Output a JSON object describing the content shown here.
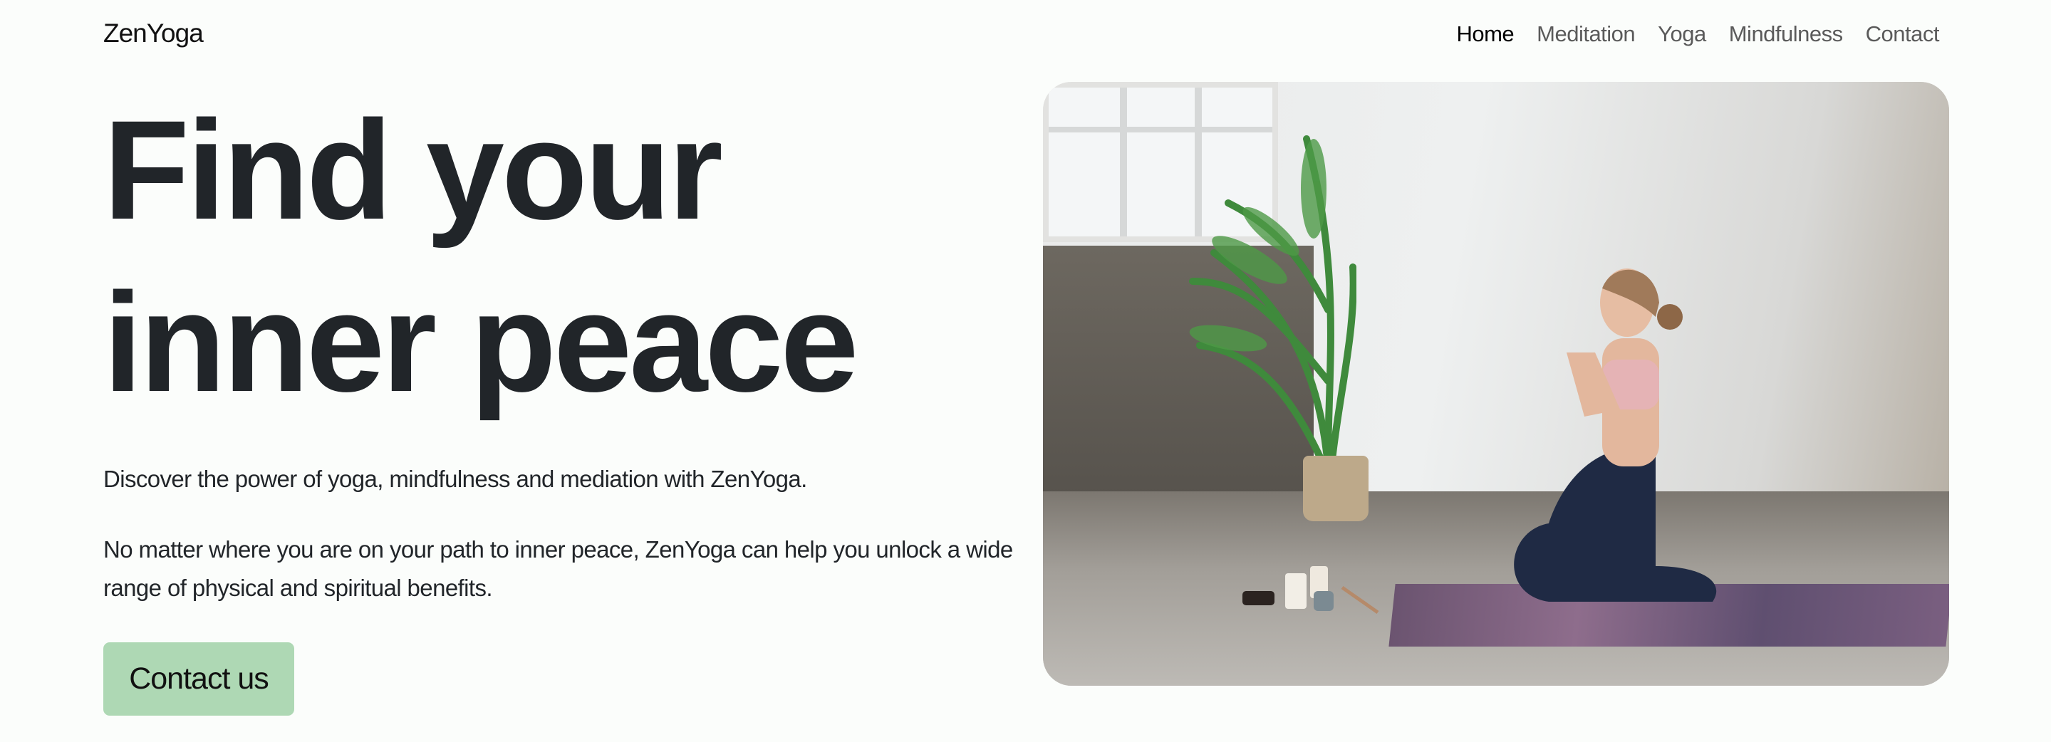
{
  "header": {
    "logo": "ZenYoga",
    "nav": [
      {
        "label": "Home",
        "active": true
      },
      {
        "label": "Meditation",
        "active": false
      },
      {
        "label": "Yoga",
        "active": false
      },
      {
        "label": "Mindfulness",
        "active": false
      },
      {
        "label": "Contact",
        "active": false
      }
    ]
  },
  "hero": {
    "title": "Find your inner peace",
    "paragraph1": "Discover the power of yoga, mindfulness and mediation with ZenYoga.",
    "paragraph2": "No matter where you are on your path to inner peace, ZenYoga can help you unlock a wide range of physical and spiritual benefits.",
    "cta_label": "Contact us",
    "image": "woman-meditating-on-yoga-mat-photo"
  },
  "colors": {
    "background": "#fbfdfb",
    "text": "#212529",
    "button": "#aed8b4",
    "nav_inactive": "#5a5a5a"
  }
}
